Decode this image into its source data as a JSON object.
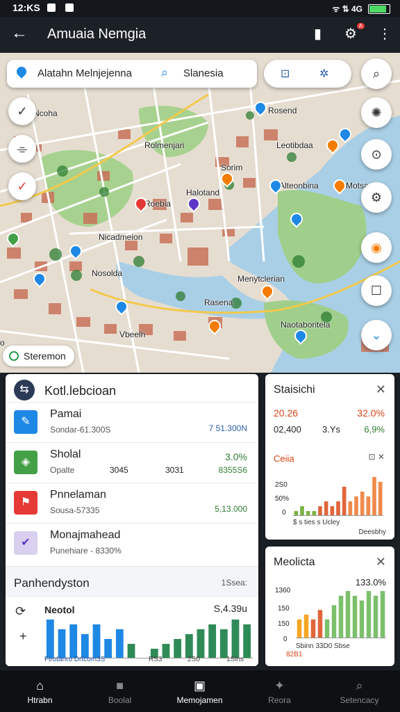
{
  "status": {
    "time": "12:KS",
    "signal": "ᯤ ⇅ 4G"
  },
  "appbar": {
    "back": "←",
    "title": "Amuaia Nemgia"
  },
  "search": {
    "location": "Alatahn Melnjejenna",
    "subject": "Slanesia"
  },
  "map_labels": [
    "Ncoha",
    "Rosend",
    "Rolmenjari",
    "Leotibdaa",
    "Sorim",
    "Halotand",
    "Motsa",
    "Alteonbina",
    "Roebia",
    "Nicadmeion",
    "Nosolda",
    "Rasena",
    "Menytclerian",
    "Naotaboritela",
    "Vbeelh",
    "o"
  ],
  "chip": {
    "label": "Steremon"
  },
  "list": {
    "header": "Kotl.lebcioan",
    "items": [
      {
        "title": "Pamai",
        "sub": "Sondar-61.300S",
        "value": "7 51.300N",
        "icon": "pencil-icon",
        "color": "#1e88e5"
      },
      {
        "title": "Sholal",
        "sub": "Opalte",
        "value": "3.0%",
        "value2": "8355S6",
        "mid1": "3045",
        "mid2": "3031",
        "icon": "shield-icon",
        "color": "#43a047"
      },
      {
        "title": "Pnnelaman",
        "sub": "Sousa-57335",
        "value": "5,13.000",
        "icon": "tag-icon",
        "color": "#e53935"
      },
      {
        "title": "Monajmahead",
        "sub": "Punehiare - 8330%",
        "icon": "check-icon",
        "color": "#b39ddb"
      }
    ]
  },
  "bottom_panel": {
    "title": "Panhendyston",
    "right": "1Ssea:",
    "chart_title": "Neotol",
    "chart_value": "S,4.39u",
    "legend_left": "Feotanro Drtcom3S",
    "ticks": [
      "RS3",
      "2S0",
      "1Slns"
    ]
  },
  "stats": {
    "title": "Staisichi",
    "row1": [
      "20.26",
      "32.0%"
    ],
    "row2": [
      "02,400",
      "3.Ys",
      "6,9%"
    ],
    "sub": "Ceiia",
    "yticks": [
      "2S0",
      "50%",
      "0"
    ],
    "xlabels": "$ s ties s Ucley",
    "footer": "Deesbhy"
  },
  "metrics": {
    "title": "Meolicta",
    "value": "133.0%",
    "yticks": [
      "1360",
      "150",
      "150",
      "0"
    ],
    "xlabels": "Sbinn 33D0 Sbse",
    "footer": "82B1"
  },
  "tabs": [
    {
      "label": "Htrabn",
      "icon": "home-icon"
    },
    {
      "label": "Boolal",
      "icon": "square-icon"
    },
    {
      "label": "Memojamen",
      "icon": "bookmark-icon"
    },
    {
      "label": "Reora",
      "icon": "people-icon"
    },
    {
      "label": "Setencacy",
      "icon": "search-icon"
    }
  ],
  "chart_data": [
    {
      "type": "bar",
      "title": "Neotol",
      "values": [
        8,
        6,
        7,
        5,
        7,
        4,
        6,
        3,
        0,
        2,
        3,
        4,
        5,
        6,
        7,
        6,
        8,
        7
      ]
    },
    {
      "type": "bar",
      "title": "Staisichi",
      "values": [
        1,
        2,
        1,
        1,
        2,
        3,
        2,
        3,
        6,
        3,
        4,
        5,
        4,
        8,
        7
      ]
    },
    {
      "type": "bar",
      "title": "Meolicta",
      "values": [
        4,
        5,
        4,
        6,
        4,
        7,
        9,
        10,
        9,
        8,
        10,
        9,
        10
      ]
    }
  ],
  "colors": {
    "blue": "#1e88e5",
    "green": "#43a047",
    "orange": "#f57c00",
    "red": "#e53935"
  }
}
